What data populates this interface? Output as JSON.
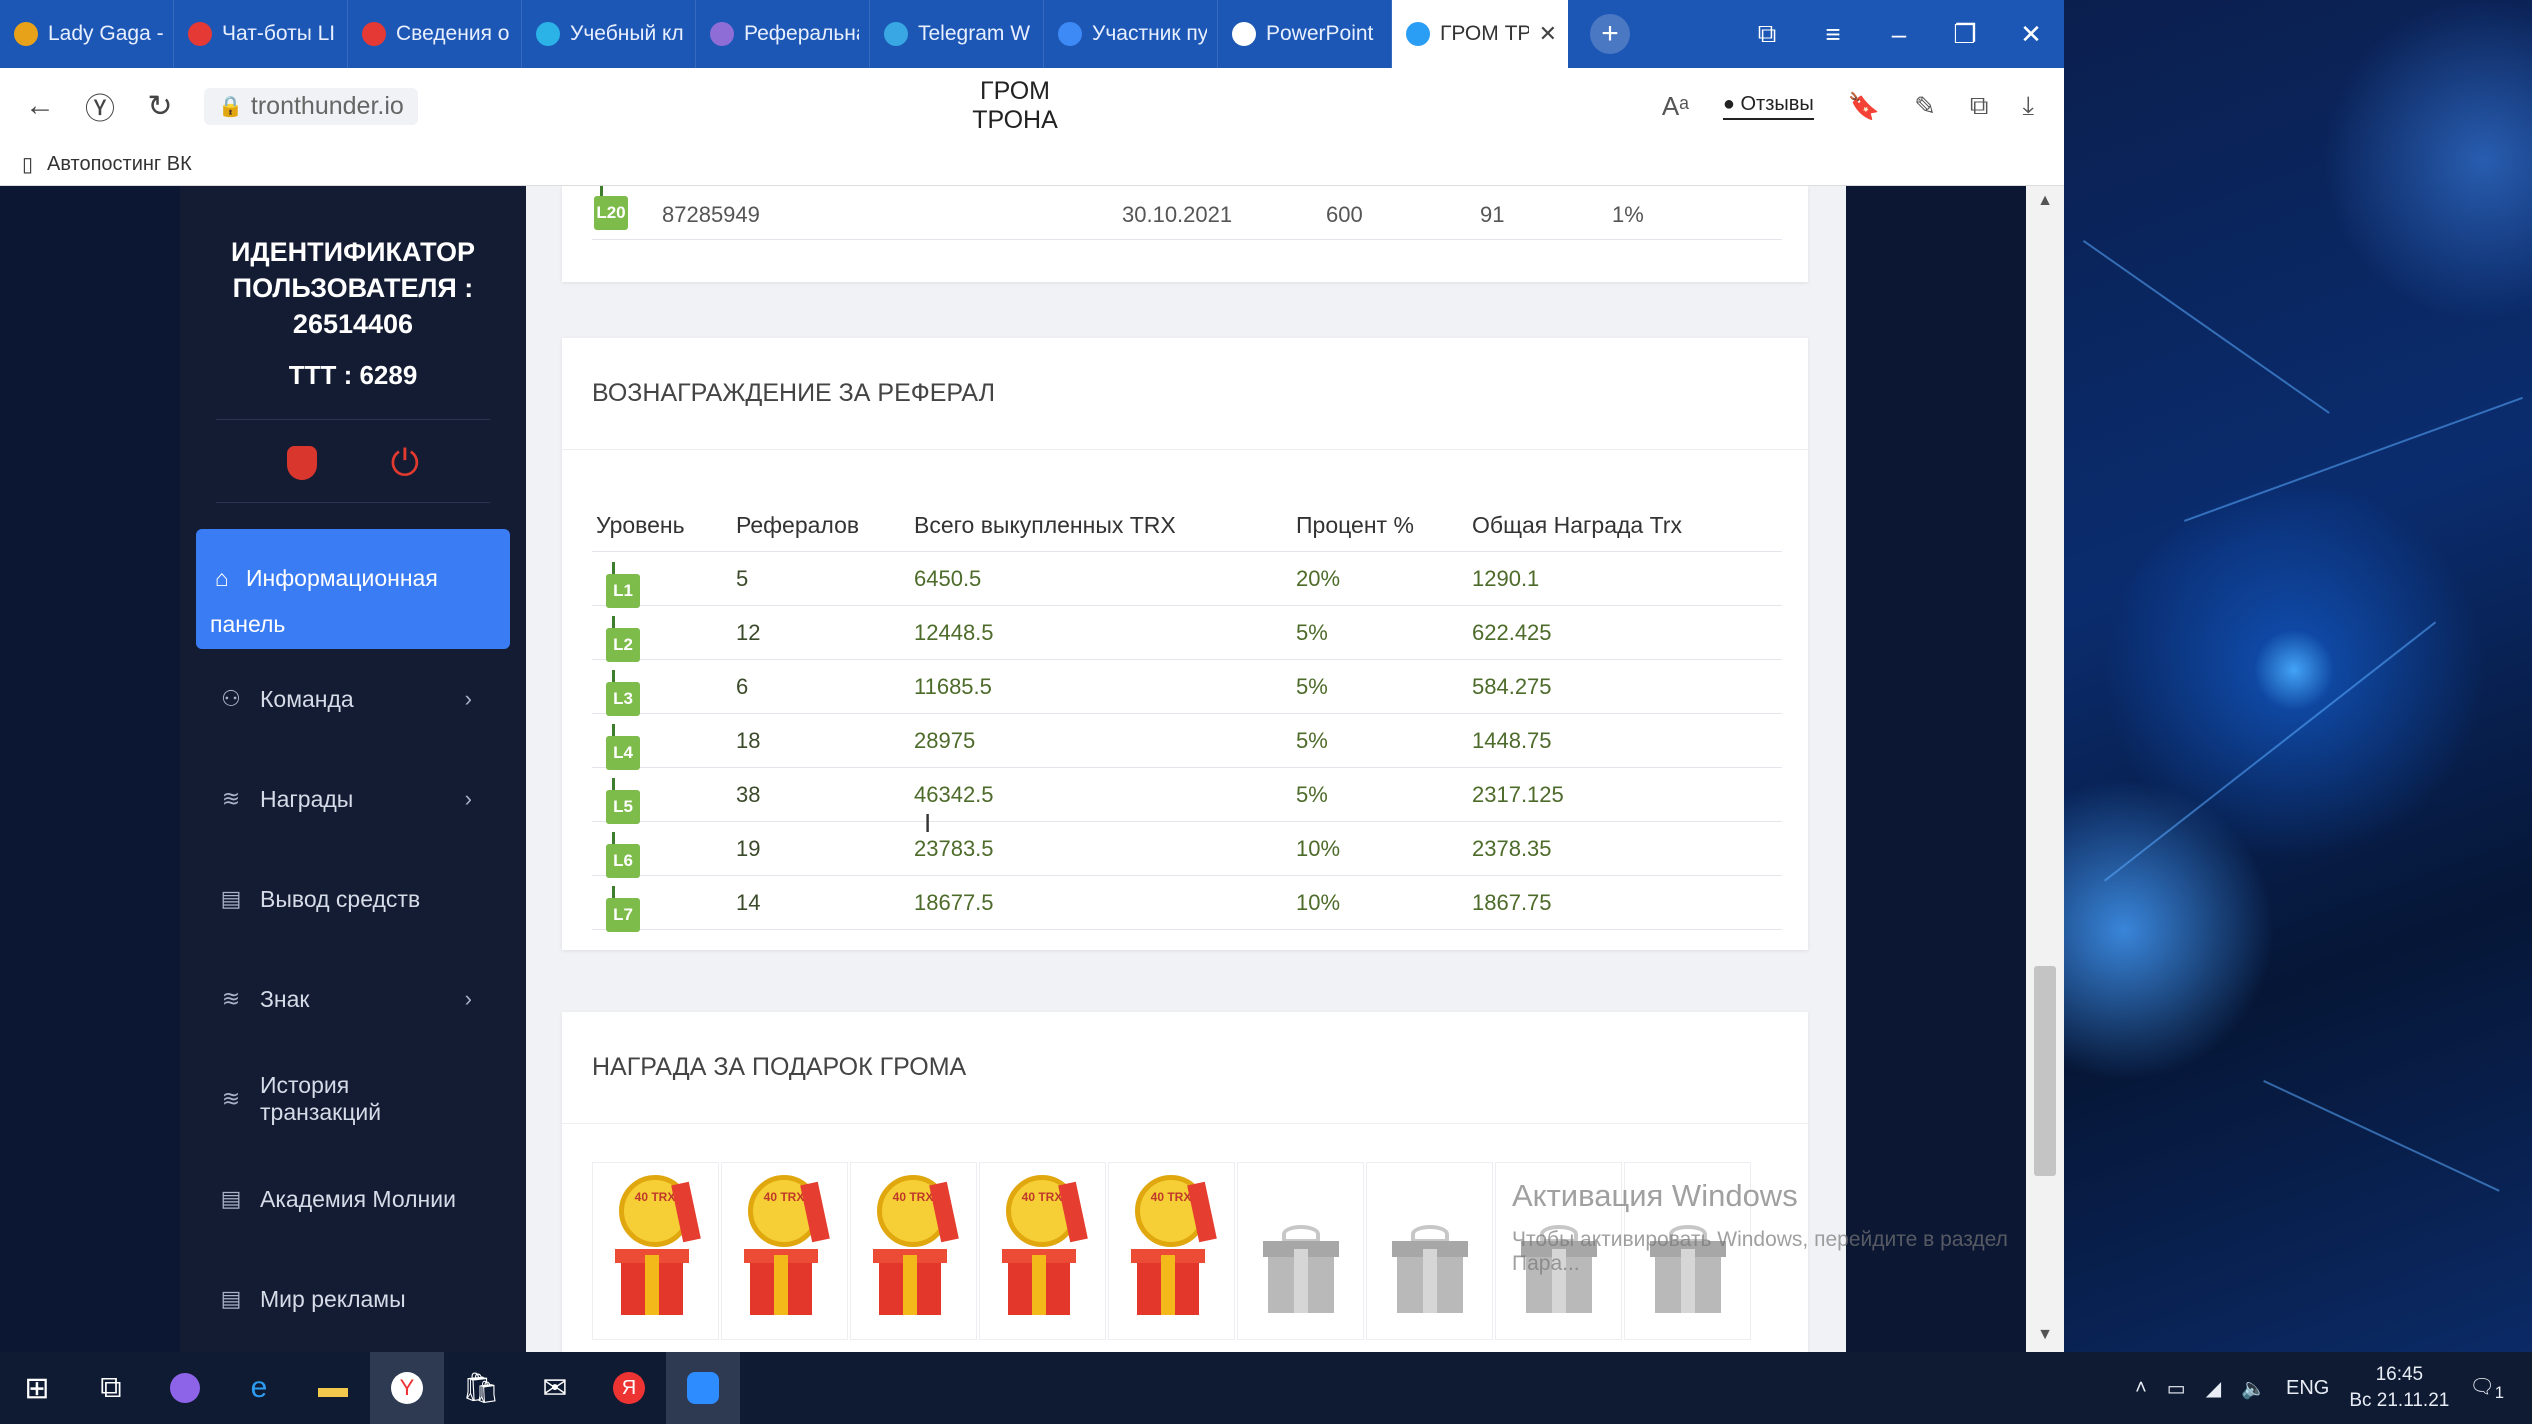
{
  "browser": {
    "tabs": [
      {
        "label": "Lady Gaga -",
        "color": "#e8a21a"
      },
      {
        "label": "Чат-боты LI",
        "color": "#e53935"
      },
      {
        "label": "Сведения о",
        "color": "#e53935"
      },
      {
        "label": "Учебный кл",
        "color": "#2bb3e8"
      },
      {
        "label": "Реферальна",
        "color": "#8e6dd7"
      },
      {
        "label": "Telegram W",
        "color": "#39a7e3"
      },
      {
        "label": "Участник пу",
        "color": "#3d8af7"
      },
      {
        "label": "PowerPoint",
        "color": "#ffffff"
      },
      {
        "label": "ГРОМ ТР",
        "color": "#2a9df4",
        "active": true
      }
    ],
    "new_tab_icon": "+",
    "url": "tronthunder.io",
    "page_title": "ГРОМ ТРОНА",
    "reviews_label": "Отзывы",
    "bookmark_label": "Автопостинг ВК"
  },
  "sidebar": {
    "user_id_label": "ИДЕНТИФИКАТОР ПОЛЬЗОВАТЕЛЯ : 26514406",
    "ttt_label": "TTT : 6289",
    "active_item": "Информационная панель",
    "items": [
      {
        "label": "Команда",
        "icon": "user-icon",
        "arrow": true
      },
      {
        "label": "Награды",
        "icon": "layers-icon",
        "arrow": true
      },
      {
        "label": "Вывод средств",
        "icon": "document-icon",
        "arrow": false
      },
      {
        "label": "Знак",
        "icon": "layers-icon",
        "arrow": true
      },
      {
        "label": "История транзакций",
        "icon": "layers-icon",
        "arrow": false
      },
      {
        "label": "Академия Молнии",
        "icon": "document-icon",
        "arrow": false
      },
      {
        "label": "Мир рекламы",
        "icon": "document-icon",
        "arrow": false
      }
    ]
  },
  "top_table_row": {
    "level": "L20",
    "id": "87285949",
    "date": "30.10.2021",
    "amount": "600",
    "count": "91",
    "percent": "1%"
  },
  "referral_reward": {
    "title": "ВОЗНАГРАЖДЕНИЕ ЗА РЕФЕРАЛ",
    "headers": [
      "Уровень",
      "Рефералов",
      "Всего выкупленных TRX",
      "Процент %",
      "Общая Награда Trx"
    ],
    "rows": [
      {
        "level": "L1",
        "referrals": "5",
        "total_trx": "6450.5",
        "percent": "20%",
        "reward": "1290.1"
      },
      {
        "level": "L2",
        "referrals": "12",
        "total_trx": "12448.5",
        "percent": "5%",
        "reward": "622.425"
      },
      {
        "level": "L3",
        "referrals": "6",
        "total_trx": "11685.5",
        "percent": "5%",
        "reward": "584.275"
      },
      {
        "level": "L4",
        "referrals": "18",
        "total_trx": "28975",
        "percent": "5%",
        "reward": "1448.75"
      },
      {
        "level": "L5",
        "referrals": "38",
        "total_trx": "46342.5",
        "percent": "5%",
        "reward": "2317.125"
      },
      {
        "level": "L6",
        "referrals": "19",
        "total_trx": "23783.5",
        "percent": "10%",
        "reward": "2378.35"
      },
      {
        "level": "L7",
        "referrals": "14",
        "total_trx": "18677.5",
        "percent": "10%",
        "reward": "1867.75"
      }
    ]
  },
  "gift_reward": {
    "title": "НАГРАДА ЗА ПОДАРОК ГРОМА",
    "coin_text": "40 TRX",
    "gifts": [
      "open",
      "open",
      "open",
      "open",
      "open",
      "locked",
      "locked",
      "locked",
      "locked"
    ]
  },
  "windows_activation": {
    "title": "Активация Windows",
    "text": "Чтобы активировать Windows, перейдите в раздел Пара..."
  },
  "taskbar": {
    "lang": "ENG",
    "time": "16:45",
    "date": "Вс 21.11.21",
    "notifications": "1"
  }
}
